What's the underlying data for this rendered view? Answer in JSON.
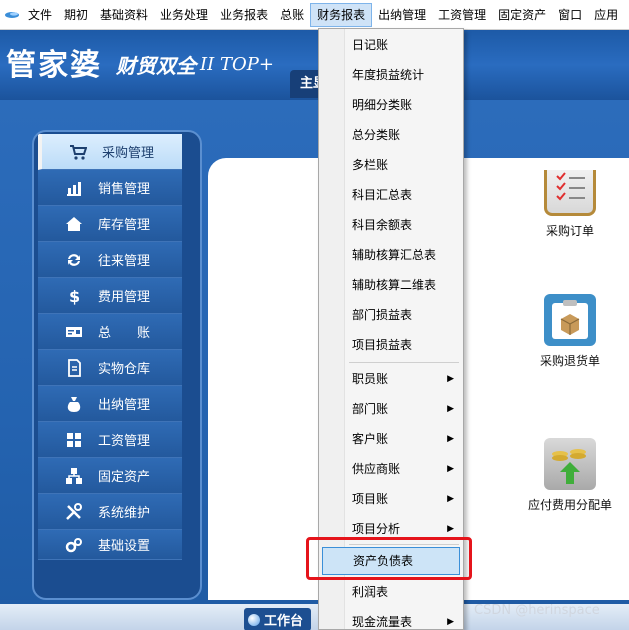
{
  "menubar": {
    "items": [
      "文件",
      "期初",
      "基础资料",
      "业务处理",
      "业务报表",
      "总账",
      "财务报表",
      "出纳管理",
      "工资管理",
      "固定资产",
      "窗口",
      "应用"
    ],
    "active_index": 6
  },
  "banner": {
    "logo_main": "管家婆",
    "logo_sub": "财贸双全",
    "logo_version": "II TOP+",
    "tab_label": "主显"
  },
  "sidebar": {
    "items": [
      {
        "label": "采购管理",
        "icon": "cart-icon"
      },
      {
        "label": "销售管理",
        "icon": "bar-chart-icon"
      },
      {
        "label": "库存管理",
        "icon": "home-icon"
      },
      {
        "label": "往来管理",
        "icon": "refresh-icon"
      },
      {
        "label": "费用管理",
        "icon": "dollar-icon"
      },
      {
        "label": "总　　账",
        "icon": "ledger-icon"
      },
      {
        "label": "实物仓库",
        "icon": "warehouse-icon"
      },
      {
        "label": "出纳管理",
        "icon": "money-bag-icon"
      },
      {
        "label": "工资管理",
        "icon": "grid-icon"
      },
      {
        "label": "固定资产",
        "icon": "hierarchy-icon"
      },
      {
        "label": "系统维护",
        "icon": "tools-icon"
      },
      {
        "label": "基础设置",
        "icon": "gears-icon"
      }
    ],
    "active_index": 0
  },
  "content": {
    "functions": [
      "采购订单",
      "采购退货单",
      "应付费用分配单"
    ]
  },
  "dropdown": {
    "items": [
      {
        "label": "日记账",
        "submenu": false
      },
      {
        "label": "年度损益统计",
        "submenu": false
      },
      {
        "label": "明细分类账",
        "submenu": false
      },
      {
        "label": "总分类账",
        "submenu": false
      },
      {
        "label": "多栏账",
        "submenu": false
      },
      {
        "label": "科目汇总表",
        "submenu": false
      },
      {
        "label": "科目余额表",
        "submenu": false
      },
      {
        "label": "辅助核算汇总表",
        "submenu": false
      },
      {
        "label": "辅助核算二维表",
        "submenu": false
      },
      {
        "label": "部门损益表",
        "submenu": false
      },
      {
        "label": "项目损益表",
        "submenu": false
      },
      {
        "label": "职员账",
        "submenu": true
      },
      {
        "label": "部门账",
        "submenu": true
      },
      {
        "label": "客户账",
        "submenu": true
      },
      {
        "label": "供应商账",
        "submenu": true
      },
      {
        "label": "项目账",
        "submenu": true
      },
      {
        "label": "项目分析",
        "submenu": true
      },
      {
        "label": "资产负债表",
        "submenu": false
      },
      {
        "label": "利润表",
        "submenu": false
      },
      {
        "label": "现金流量表",
        "submenu": true
      }
    ],
    "highlight_index": 17,
    "submenu_arrow": "▶"
  },
  "bottom": {
    "workbench_label": "工作台",
    "watermark": "CSDN @herinspace"
  },
  "colors": {
    "accent_blue": "#2463b0",
    "highlight": "#cde4f7",
    "red_outline": "#e5141b"
  }
}
